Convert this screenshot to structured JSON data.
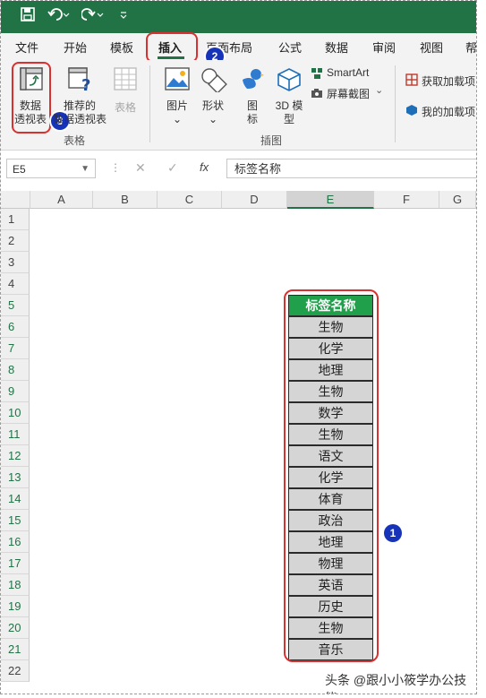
{
  "menu": [
    "文件",
    "开始",
    "模板",
    "插入",
    "页面布局",
    "公式",
    "数据",
    "审阅",
    "视图",
    "帮"
  ],
  "ribbon": {
    "pivot": [
      "数据",
      "透视表"
    ],
    "recommended": [
      "推荐的",
      "数据透视表"
    ],
    "table": "表格",
    "picture": "图片",
    "shapes": "形状",
    "icons": [
      "图",
      "标"
    ],
    "model3d": [
      "3D 模",
      "型"
    ],
    "smartart": "SmartArt",
    "screenshot": "屏幕截图",
    "get_addins": "获取加载项",
    "my_addins": "我的加载项",
    "group_tables": "表格",
    "group_illustrations": "插图"
  },
  "formula": {
    "cell_ref": "E5",
    "content": "标签名称",
    "fx": "fx"
  },
  "columns": [
    "A",
    "B",
    "C",
    "D",
    "E",
    "F",
    "G"
  ],
  "rows": [
    "1",
    "2",
    "3",
    "4",
    "5",
    "6",
    "7",
    "8",
    "9",
    "10",
    "11",
    "12",
    "13",
    "14",
    "15",
    "16",
    "17",
    "18",
    "19",
    "20",
    "21",
    "22"
  ],
  "table": {
    "header": "标签名称",
    "values": [
      "生物",
      "化学",
      "地理",
      "生物",
      "数学",
      "生物",
      "语文",
      "化学",
      "体育",
      "政治",
      "地理",
      "物理",
      "英语",
      "历史",
      "生物",
      "音乐"
    ]
  },
  "callouts": [
    "1",
    "2",
    "3"
  ],
  "watermark": "头条 @跟小小筱学办公技能"
}
